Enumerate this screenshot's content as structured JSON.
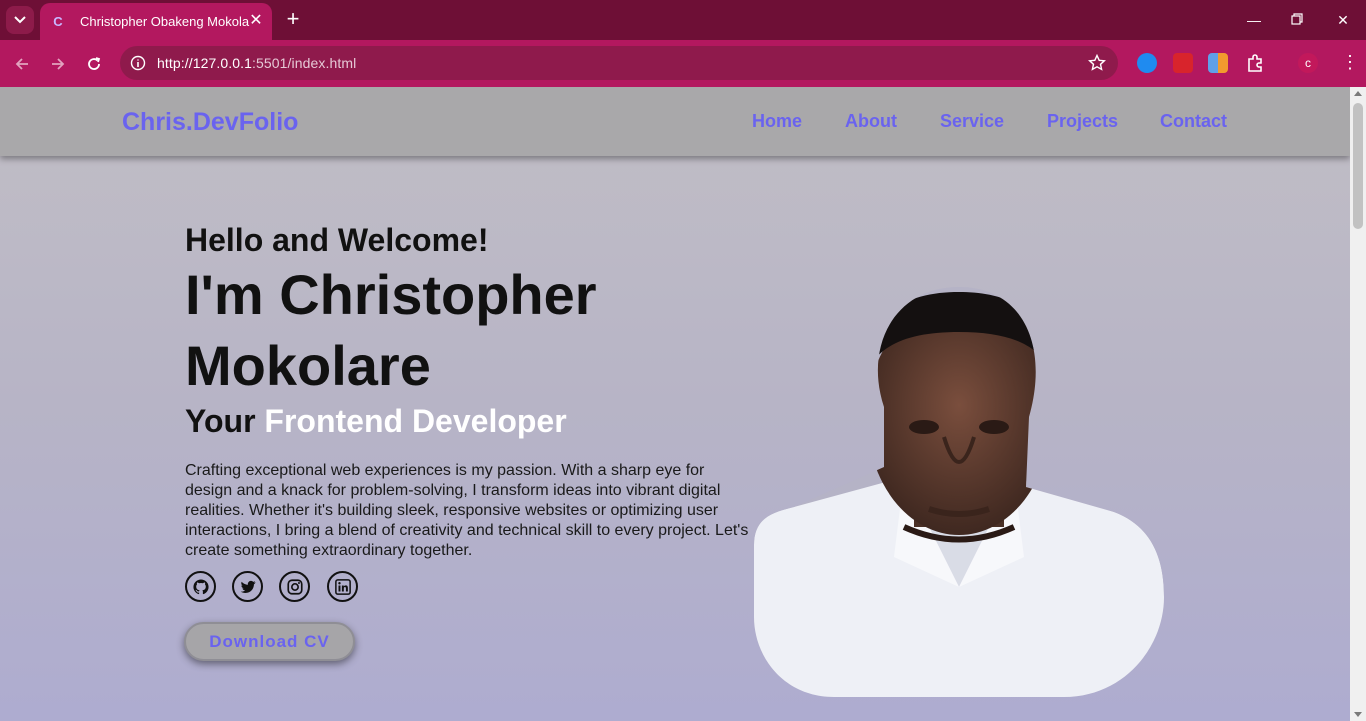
{
  "browser": {
    "tab_title": "Christopher Obakeng Mokolare",
    "tab_favicon": "C",
    "url_host": "http://127.0.0.1",
    "url_rest": ":5501/index.html",
    "profile_initial": "c"
  },
  "site": {
    "logo": "Chris.DevFolio",
    "nav": [
      "Home",
      "About",
      "Service",
      "Projects",
      "Contact"
    ]
  },
  "hero": {
    "greeting": "Hello and Welcome!",
    "name": "I'm Christopher Mokolare",
    "role_prefix": "Your",
    "role_highlight": "Frontend Developer",
    "description": "Crafting exceptional web experiences is my passion. With a sharp eye for design and a knack for problem-solving, I transform ideas into vibrant digital realities. Whether it's building sleek, responsive websites or optimizing user interactions, I bring a blend of creativity and technical skill to every project. Let's create something extraordinary together.",
    "cta": "Download CV",
    "social_icons": [
      "github-icon",
      "twitter-icon",
      "instagram-icon",
      "linkedin-icon"
    ]
  },
  "colors": {
    "accent": "#6a63ef",
    "browser_frame": "#b3185f",
    "tabbar": "#6e0f36"
  }
}
